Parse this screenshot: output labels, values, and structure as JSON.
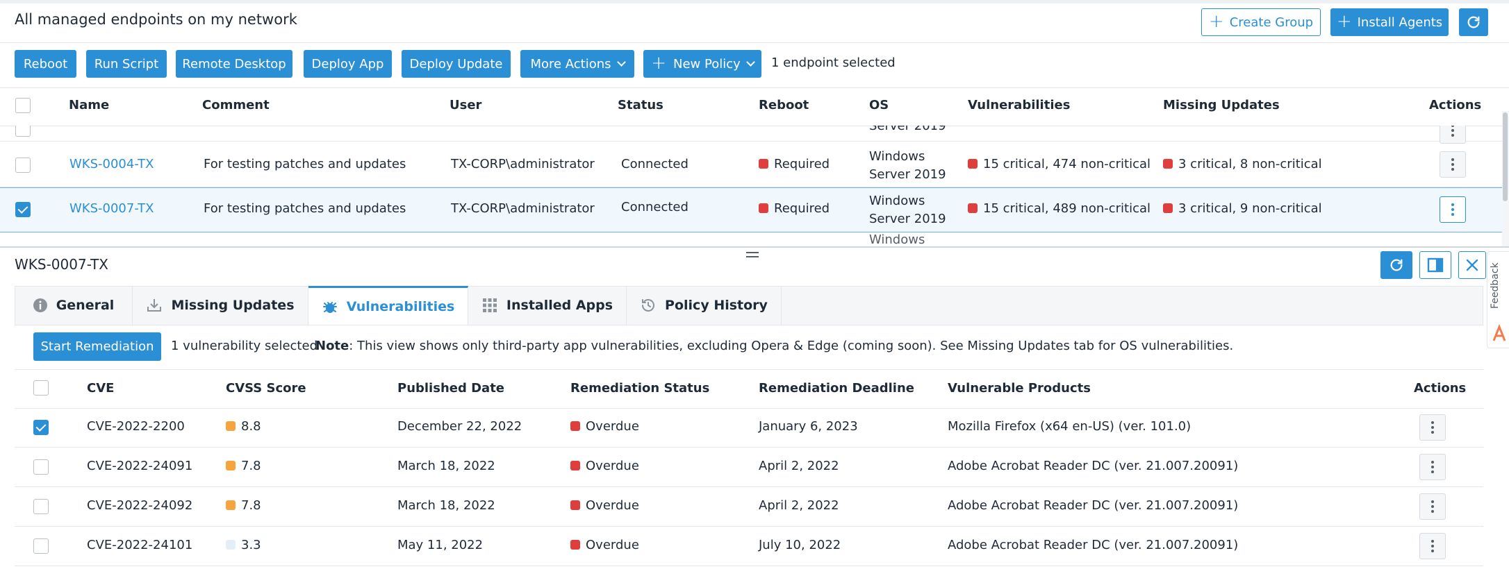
{
  "header": {
    "title": "All managed endpoints on my network",
    "create_group": "Create Group",
    "install_agents": "Install Agents"
  },
  "toolbar": {
    "reboot": "Reboot",
    "run_script": "Run Script",
    "remote_desktop": "Remote Desktop",
    "deploy_app": "Deploy App",
    "deploy_update": "Deploy Update",
    "more_actions": "More Actions",
    "new_policy": "New Policy",
    "selection": "1 endpoint selected"
  },
  "endpoints": {
    "columns": [
      "Name",
      "Comment",
      "User",
      "Status",
      "Reboot",
      "OS",
      "Vulnerabilities",
      "Missing Updates",
      "Actions"
    ],
    "partial_top_os": "Server 2019",
    "partial_bottom_os": "Windows",
    "rows": [
      {
        "name": "WKS-0004-TX",
        "comment": "For testing patches and updates",
        "user": "TX-CORP\\administrator",
        "status": "Connected",
        "reboot": "Required",
        "os_line1": "Windows",
        "os_line2": "Server 2019",
        "vulnerabilities": "15 critical,  474 non-critical",
        "missing_updates": "3 critical,  8 non-critical",
        "selected": false
      },
      {
        "name": "WKS-0007-TX",
        "comment": "For testing patches and updates",
        "user": "TX-CORP\\administrator",
        "status": "Connected",
        "reboot": "Required",
        "os_line1": "Windows",
        "os_line2": "Server 2019",
        "vulnerabilities": "15 critical,  489 non-critical",
        "missing_updates": "3 critical,  9 non-critical",
        "selected": true
      }
    ]
  },
  "detail": {
    "title": "WKS-0007-TX",
    "tabs": [
      {
        "label": "General",
        "icon": "info-icon"
      },
      {
        "label": "Missing Updates",
        "icon": "download-icon"
      },
      {
        "label": "Vulnerabilities",
        "icon": "bug-icon",
        "active": true
      },
      {
        "label": "Installed Apps",
        "icon": "grid-icon"
      },
      {
        "label": "Policy History",
        "icon": "history-icon"
      }
    ],
    "start_remediation": "Start Remediation",
    "selection": "1 vulnerability selected",
    "note_label": "Note",
    "note_text": ": This view shows only third-party app vulnerabilities, excluding Opera & Edge (coming soon). See Missing Updates tab for OS vulnerabilities."
  },
  "vulnerabilities": {
    "columns": [
      "CVE",
      "CVSS Score",
      "Published Date",
      "Remediation Status",
      "Remediation Deadline",
      "Vulnerable Products",
      "Actions"
    ],
    "rows": [
      {
        "cve": "CVE-2022-2200",
        "score": "8.8",
        "score_color": "#f5a53b",
        "published": "December 22, 2022",
        "status": "Overdue",
        "deadline": "January 6, 2023",
        "product": "Mozilla Firefox (x64 en-US) (ver. 101.0)",
        "selected": true
      },
      {
        "cve": "CVE-2022-24091",
        "score": "7.8",
        "score_color": "#f5a53b",
        "published": "March 18, 2022",
        "status": "Overdue",
        "deadline": "April 2, 2022",
        "product": "Adobe Acrobat Reader DC (ver. 21.007.20091)",
        "selected": false
      },
      {
        "cve": "CVE-2022-24092",
        "score": "7.8",
        "score_color": "#f5a53b",
        "published": "March 18, 2022",
        "status": "Overdue",
        "deadline": "April 2, 2022",
        "product": "Adobe Acrobat Reader DC (ver. 21.007.20091)",
        "selected": false
      },
      {
        "cve": "CVE-2022-24101",
        "score": "3.3",
        "score_color": "#e3eef7",
        "published": "May 11, 2022",
        "status": "Overdue",
        "deadline": "July 10, 2022",
        "product": "Adobe Acrobat Reader DC (ver. 21.007.20091)",
        "selected": false
      }
    ]
  },
  "feedback": "Feedback",
  "colors": {
    "accent": "#2b8fd6",
    "critical": "#e03d3d",
    "warning": "#f5a53b"
  }
}
